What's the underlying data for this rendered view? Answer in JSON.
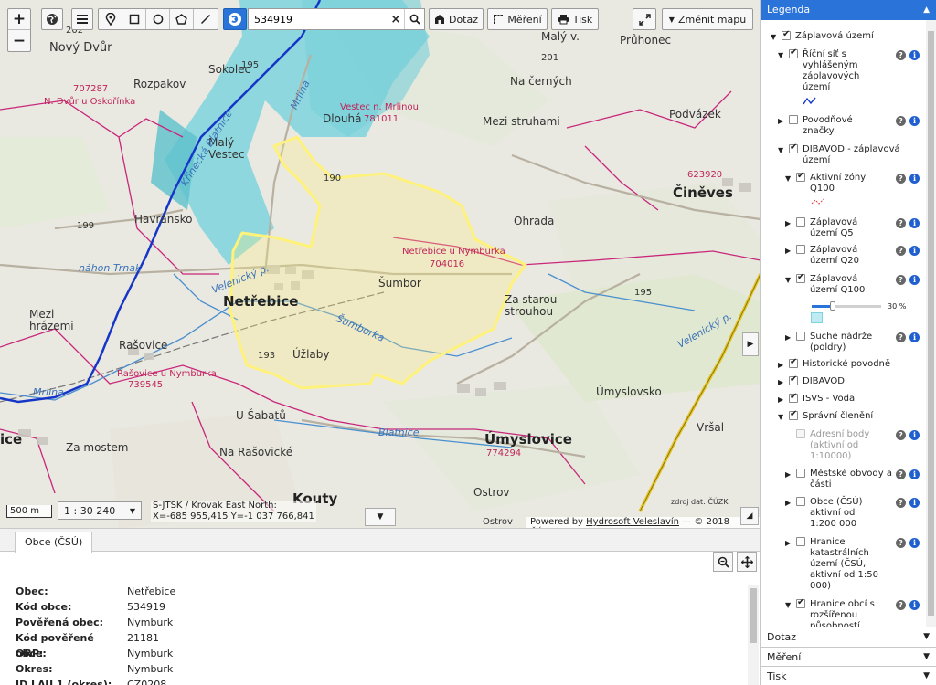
{
  "toolbar": {
    "zoom_in": "+",
    "zoom_out": "−",
    "search_value": "534919",
    "query_label": "Dotaz",
    "measure_label": "Měření",
    "print_label": "Tisk",
    "change_map_label": "Změnit mapu"
  },
  "map": {
    "places": {
      "novy_dvur": "Nový Dvůr",
      "rozpakov": "Rozpakov",
      "sokolec": "Sokolec",
      "dlouha": "Dlouhá",
      "maly_vestec": "Malý Vestec",
      "havransko": "Havransko",
      "mezi_hrazemi": "Mezi hrázemi",
      "rasovice": "Rašovice",
      "netrebice": "Netřebice",
      "sumbor": "Šumbor",
      "uzlaby": "Úžlaby",
      "ohrada": "Ohrada",
      "za_starou_strouhou": "Za starou strouhou",
      "mezi_struhami": "Mezi struhami",
      "na_cernych": "Na černých",
      "podvazek": "Podvázek",
      "cineves": "Činěves",
      "maly_v": "Malý v.",
      "pruhonec": "Průhonec",
      "umyslovsko": "Úmyslovsko",
      "umyslovice": "Úmyslovice",
      "u_sabatu": "U Šabatů",
      "na_rasovicke": "Na Rašovické",
      "za_mostem": "Za mostem",
      "kouty": "Kouty",
      "ostrov": "Ostrov",
      "ostrov2": "Ostrov",
      "vrsal": "Vršal",
      "ice": "ice"
    },
    "cadastre": {
      "c707287": "707287",
      "n_dvur": "N. Dvůr u Oskořínka",
      "vestec": "Vestec n. Mrlinou",
      "c781011": "781011",
      "netrebice_nymburka": "Netřebice u Nymburka",
      "c704016": "704016",
      "c623920": "623920",
      "rasovice_nymburka": "Rašovice u Nymburka",
      "c739545": "739545",
      "c774294": "774294"
    },
    "water": {
      "krinecka_blatnice": "Křinecká Blatnice",
      "nahon": "náhon Trnak",
      "velenicky": "Velenický p.",
      "velenicky2": "Velenický p.",
      "sumborka": "Šumborka",
      "mrlina": "Mrlina",
      "mrlina2": "Mrlina",
      "blatnice": "Blatnice"
    },
    "elevations": {
      "e190": "190",
      "e193": "193",
      "e199": "199",
      "e195": "195",
      "e195b": "195",
      "e201": "201",
      "e202": "202"
    },
    "scale_bar": "500 m",
    "scale_select": "1 : 30 240",
    "coord_line1": "S-JTSK / Krovak East North:",
    "coord_line2": "X=-685 955,415 Y=-1 037 766,841",
    "attribution_prefix": "Powered by",
    "attribution_link": "Hydrosoft Veleslavín",
    "attribution_suffix": "— © 2018 ČÚZK",
    "source_note": "zdroj dat: ČÚZK"
  },
  "bottom": {
    "tab_label": "Obce (ČSÚ)",
    "attributes": [
      {
        "key": "Obec:",
        "value": "Netřebice"
      },
      {
        "key": "Kód obce:",
        "value": "534919"
      },
      {
        "key": "Pověřená obec:",
        "value": "Nymburk"
      },
      {
        "key": "Kód pověřené obce:",
        "value": "21181"
      },
      {
        "key": "ORP:",
        "value": "Nymburk"
      },
      {
        "key": "Okres:",
        "value": "Nymburk"
      },
      {
        "key": "ID LAU 1 (okres):",
        "value": "CZ0208"
      }
    ]
  },
  "legend": {
    "title": "Legenda",
    "items": {
      "zaplavova_uzemi": "Záplavová území",
      "ricni_sit": "Říční síť s vyhlášeným záplavových území",
      "povodnove_znacky": "Povodňové značky",
      "dibavod_zaplavova": "DIBAVOD - záplavová území",
      "aktivni_zony": "Aktivní zóny Q100",
      "q5": "Záplavová území Q5",
      "q20": "Záplavová území Q20",
      "q100": "Záplavová území Q100",
      "opacity": "30 %",
      "opacity_fraction": 0.3,
      "suche_nadrze": "Suché nádrže (poldry)",
      "historicke": "Historické povodně",
      "dibavod": "DIBAVOD",
      "isvs": "ISVS - Voda",
      "spravni": "Správní členění",
      "adresni_body": "Adresní body (aktivní od 1:10000)",
      "mestske_obvody": "Městské obvody a části",
      "obce": "Obce (ČSÚ) aktivní od 1:200 000",
      "hranice_katastralnich": "Hranice katastrálních území (ČSÚ, aktivní od 1:50 000)",
      "hranice_obci": "Hranice obcí s rozšířenou působností"
    },
    "accordion": {
      "dotaz": "Dotaz",
      "mereni": "Měření",
      "tisk": "Tisk"
    }
  },
  "colors": {
    "accent": "#2a73d9",
    "flood": "#7fd3dd",
    "selection": "#fff27a",
    "boundary": "#c8277a",
    "river": "#1636c8"
  }
}
